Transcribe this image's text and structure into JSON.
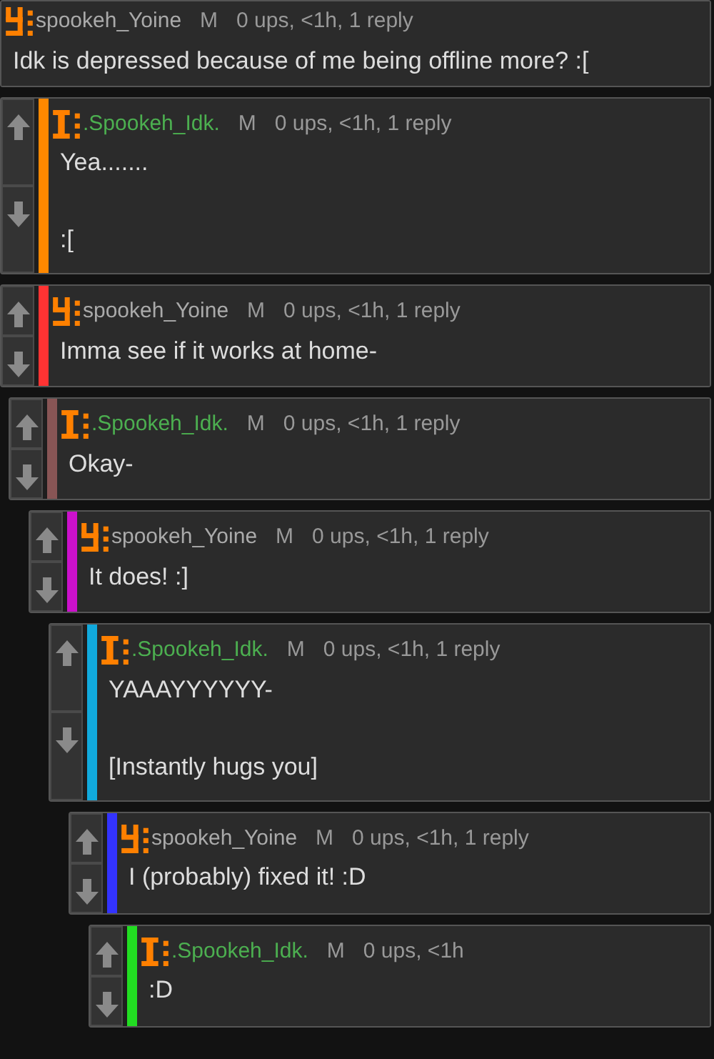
{
  "comments": [
    {
      "kind": "yoine",
      "username": "spookeh_Yoine",
      "badge": "M",
      "meta": "0 ups, <1h, 1 reply",
      "lines": [
        "Idk is depressed because of me being offline more? :["
      ],
      "children": [
        {
          "kind": "idk",
          "username": ".Spookeh_Idk.",
          "badge": "M",
          "meta": "0 ups, <1h, 1 reply",
          "color": "#ff8800",
          "lines": [
            "Yea.......",
            ":["
          ],
          "children": [
            {
              "kind": "yoine",
              "username": "spookeh_Yoine",
              "badge": "M",
              "meta": "0 ups, <1h, 1 reply",
              "color": "#ff3333",
              "lines": [
                "Imma see if it works at home-"
              ],
              "children": [
                {
                  "kind": "idk",
                  "username": ".Spookeh_Idk.",
                  "badge": "M",
                  "meta": "0 ups, <1h, 1 reply",
                  "color": "#885555",
                  "lines": [
                    "Okay-"
                  ],
                  "children": [
                    {
                      "kind": "yoine",
                      "username": "spookeh_Yoine",
                      "badge": "M",
                      "meta": "0 ups, <1h, 1 reply",
                      "color": "#cc11cc",
                      "lines": [
                        "It does! :]"
                      ],
                      "children": [
                        {
                          "kind": "idk",
                          "username": ".Spookeh_Idk.",
                          "badge": "M",
                          "meta": "0 ups, <1h, 1 reply",
                          "color": "#11aadd",
                          "lines": [
                            "YAAAYYYYYY-",
                            "[Instantly hugs you]"
                          ],
                          "children": [
                            {
                              "kind": "yoine",
                              "username": "spookeh_Yoine",
                              "badge": "M",
                              "meta": "0 ups, <1h, 1 reply",
                              "color": "#3333ff",
                              "lines": [
                                "I (probably) fixed it! :D"
                              ],
                              "children": [
                                {
                                  "kind": "idk",
                                  "username": ".Spookeh_Idk.",
                                  "badge": "M",
                                  "meta": "0 ups, <1h",
                                  "color": "#22dd22",
                                  "lines": [
                                    ":D"
                                  ]
                                }
                              ]
                            }
                          ]
                        }
                      ]
                    }
                  ]
                }
              ]
            }
          ]
        }
      ]
    }
  ]
}
